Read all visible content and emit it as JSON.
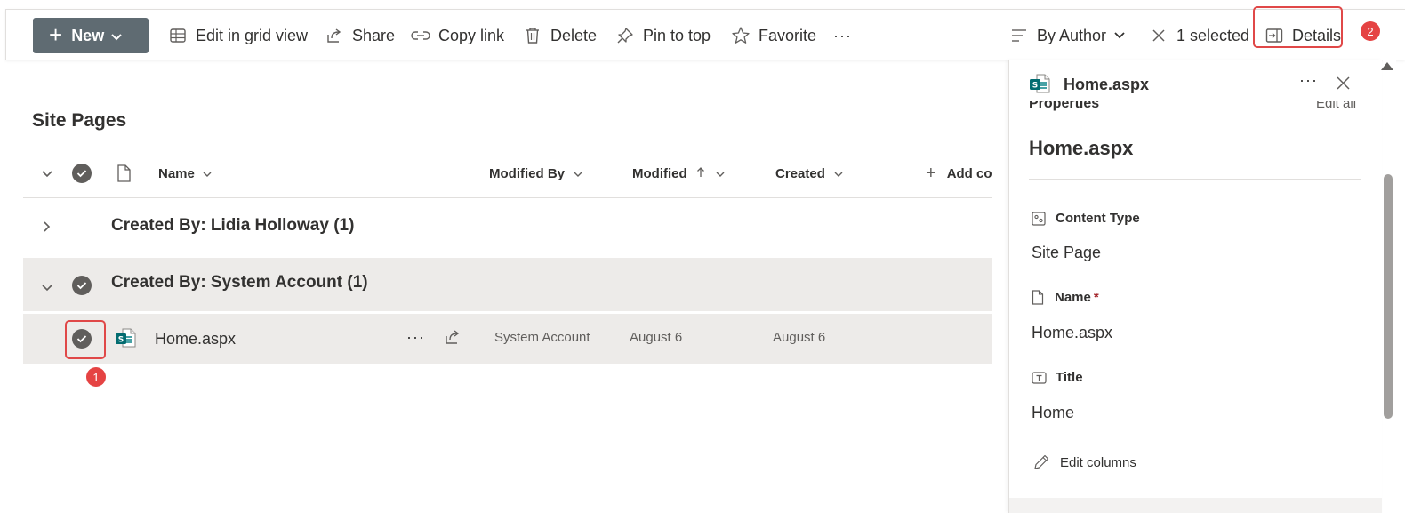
{
  "toolbar": {
    "new_label": "New",
    "edit_grid_label": "Edit in grid view",
    "share_label": "Share",
    "copy_link_label": "Copy link",
    "delete_label": "Delete",
    "pin_label": "Pin to top",
    "favorite_label": "Favorite",
    "more_label": "···",
    "view_label": "By Author",
    "selected_label": "1 selected",
    "details_label": "Details"
  },
  "annotations": {
    "badge1": "1",
    "badge2": "2",
    "highlight_color": "#e04848"
  },
  "list": {
    "title": "Site Pages",
    "columns": {
      "name": "Name",
      "modified_by": "Modified By",
      "modified": "Modified",
      "created": "Created",
      "add_column": "Add co"
    },
    "groups": [
      {
        "label": "Created By: Lidia Holloway (1)",
        "expanded": false
      },
      {
        "label": "Created By: System Account (1)",
        "expanded": true
      }
    ],
    "item": {
      "name": "Home.aspx",
      "modified_by": "System Account",
      "modified": "August 6",
      "created": "August 6"
    }
  },
  "details": {
    "file_name": "Home.aspx",
    "properties_label": "Properties",
    "edit_all_label": "Edit all",
    "heading": "Home.aspx",
    "fields": {
      "content_type_label": "Content Type",
      "content_type_value": "Site Page",
      "name_label": "Name",
      "name_required": "*",
      "name_value": "Home.aspx",
      "title_label": "Title",
      "title_value": "Home"
    },
    "edit_columns_label": "Edit columns"
  },
  "colors": {
    "accent": "#5f6b72",
    "sharepoint_icon": "#036c70",
    "selected_row": "#edebe9"
  }
}
